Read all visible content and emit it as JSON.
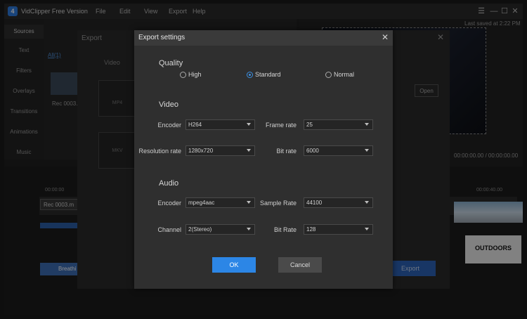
{
  "app": {
    "title": "VidClipper Free Version",
    "logo": "4"
  },
  "menu": [
    "File",
    "Edit",
    "View",
    "Export",
    "Help"
  ],
  "window_icons": {
    "menu": "☰",
    "minimize": "—",
    "maximize": "☐",
    "close": "✕"
  },
  "sidebar": {
    "items": [
      "Sources",
      "Text",
      "Filters",
      "Overlays",
      "Transitions",
      "Animations",
      "Music"
    ]
  },
  "media": {
    "tab": "All(1)",
    "clip_label": "Rec 0003.n"
  },
  "preview": {
    "saved": "Last saved at 2:22 PM",
    "time": "00:00:00.00 / 00:00:00.00"
  },
  "timeline": {
    "clip": "Rec 0003.m",
    "breath": "Breathi",
    "outdoors": "OUTDOORS",
    "marker1": "00:00:00",
    "marker2": "00:00:40.00"
  },
  "export_bg": {
    "title": "Export",
    "video": "Video",
    "formats": [
      "MP4",
      "MKV"
    ],
    "open": "Open",
    "export_button": "Export"
  },
  "dialog": {
    "title": "Export settings",
    "close": "✕",
    "quality": {
      "label": "Quality",
      "options": [
        "High",
        "Standard",
        "Normal"
      ],
      "selected": "Standard"
    },
    "video": {
      "label": "Video",
      "encoder_label": "Encoder",
      "encoder": "H264",
      "frame_rate_label": "Frame rate",
      "frame_rate": "25",
      "resolution_label": "Resolution rate",
      "resolution": "1280x720",
      "bit_rate_label": "Bit rate",
      "bit_rate": "6000"
    },
    "audio": {
      "label": "Audio",
      "encoder_label": "Encoder",
      "encoder": "mpeg4aac",
      "sample_rate_label": "Sample Rate",
      "sample_rate": "44100",
      "channel_label": "Channel",
      "channel": "2(Stereo)",
      "bit_rate_label": "Bit Rate",
      "bit_rate": "128"
    },
    "ok": "OK",
    "cancel": "Cancel"
  }
}
